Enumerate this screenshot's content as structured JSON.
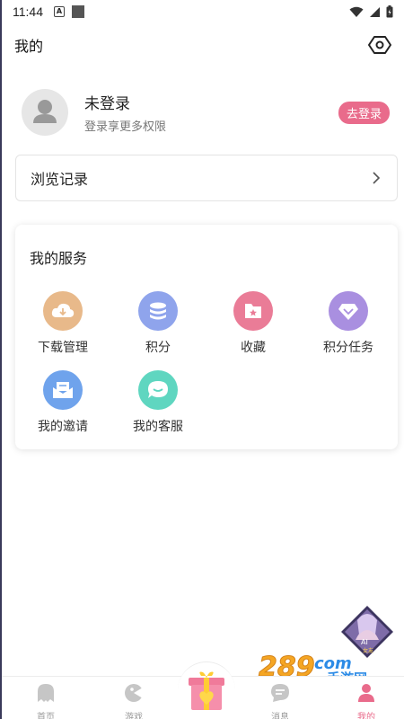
{
  "status_bar": {
    "time": "11:44",
    "notif_a": "A"
  },
  "header": {
    "title": "我的"
  },
  "profile": {
    "name": "未登录",
    "subtitle": "登录享更多权限",
    "login_label": "去登录"
  },
  "history": {
    "label": "浏览记录"
  },
  "services": {
    "title": "我的服务",
    "items": [
      {
        "label": "下载管理",
        "icon": "download-cloud-icon",
        "color": "#e8b98a"
      },
      {
        "label": "积分",
        "icon": "coins-icon",
        "color": "#8fa4ec"
      },
      {
        "label": "收藏",
        "icon": "favorite-folder-icon",
        "color": "#ea7c97"
      },
      {
        "label": "积分任务",
        "icon": "diamond-icon",
        "color": "#a98fe0"
      },
      {
        "label": "我的邀请",
        "icon": "mail-icon",
        "color": "#6fa3ec"
      },
      {
        "label": "我的客服",
        "icon": "chat-icon",
        "color": "#5fd6c0"
      }
    ]
  },
  "bottom_nav": {
    "items": [
      {
        "label": "首页",
        "icon": "ghost-icon"
      },
      {
        "label": "游戏",
        "icon": "gamepad-icon"
      },
      {
        "label": "消息",
        "icon": "message-icon"
      },
      {
        "label": "我的",
        "icon": "user-icon"
      }
    ],
    "active": "我的",
    "center": "gift-icon"
  },
  "accent_color": "#e96b8b",
  "watermark": {
    "number": "289",
    "suffix": "com",
    "text": "手游网"
  },
  "float_badge": {
    "text": "AI",
    "subtext": "女友"
  }
}
